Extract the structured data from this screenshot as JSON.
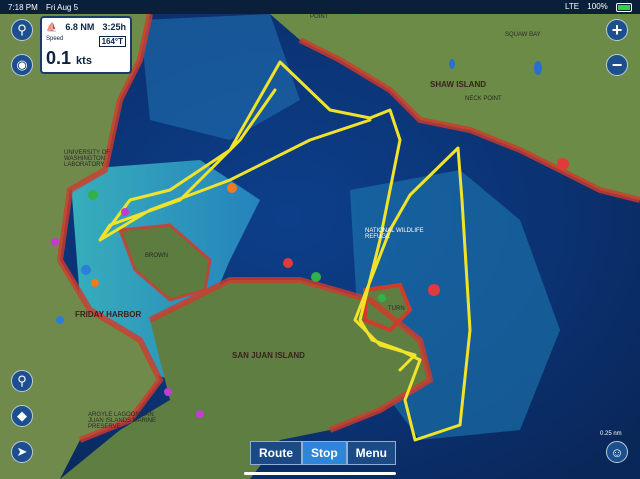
{
  "status_bar": {
    "time": "7:18 PM",
    "date": "Fri Aug 5",
    "signal": "LTE",
    "battery": "100%"
  },
  "dashboard": {
    "distance": "6.8 NM",
    "eta": "3:25h",
    "speed_label": "Speed",
    "speed_value": "0.1",
    "speed_unit": "kts",
    "heading": "164°T"
  },
  "map_labels": {
    "friday_harbor": "FRIDAY HARBOR",
    "san_juan_island": "SAN JUAN ISLAND",
    "shaw_island": "SHAW ISLAND",
    "brown": "BROWN",
    "turn": "TURN",
    "university": "UNIVERSITY OF WASHINGTON LABORATORY",
    "point": "POINT",
    "squaw_bay": "SQUAW BAY",
    "neck_point": "NECK POINT",
    "refuge": "NATIONAL WILDLIFE REFUGE",
    "argyle": "ARGYLE LAGOON SAN JUAN ISLANDS MARINE PRESERVE"
  },
  "bottom_bar": {
    "route": "Route",
    "stop": "Stop",
    "menu": "Menu"
  },
  "scale": "0.25 nm",
  "colors": {
    "track": "#f0e32a",
    "deep_water": "#0b2f63",
    "shallow_water": "#2bb6c9",
    "shore": "#d23a2a",
    "land": "#6f8a4a",
    "button": "#1d4f8f",
    "active_button": "#2e86d8"
  },
  "icons": [
    "search-icon",
    "camera-icon",
    "pin-icon",
    "layers-icon",
    "location-arrow-icon",
    "zoom-in-icon",
    "zoom-out-icon",
    "user-icon"
  ]
}
